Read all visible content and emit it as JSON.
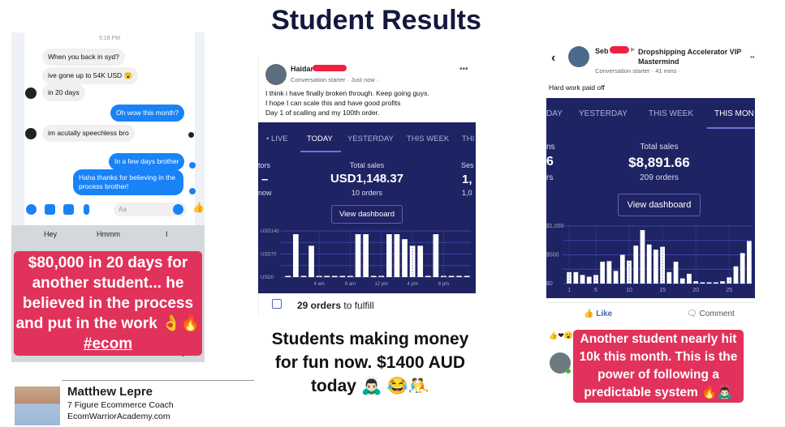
{
  "title": "Student Results",
  "chat": {
    "time": "5:18 PM",
    "messages": [
      {
        "dir": "in",
        "text": "When you back in syd?"
      },
      {
        "dir": "in",
        "text": "ive gone up to 54K USD 😮"
      },
      {
        "dir": "in",
        "text": "in 20 days"
      },
      {
        "dir": "out",
        "text": "Oh wow this month?"
      },
      {
        "dir": "in",
        "text": "im acutally speechless bro"
      },
      {
        "dir": "out",
        "text": "In a few days brother"
      },
      {
        "dir": "out",
        "text": "Haha thanks for believing in the process brother!"
      }
    ],
    "input_placeholder": "Aa",
    "suggestions": [
      "Hey",
      "Hmmm",
      "I"
    ],
    "caption": "$80,000 in 20 days for another student... he believed in the process and put in the work 👌🔥",
    "hashtag": "#ecom"
  },
  "coach": {
    "name": "Matthew Lepre",
    "role": "7 Figure Ecommerce Coach",
    "site": "EcomWarriorAcademy.com"
  },
  "post1": {
    "author": "Haidar",
    "meta": "Conversation starter · Just now ·",
    "text": [
      "I think i have finally broken through. Keep going guys.",
      "I hope I can scale this and have good profits",
      "Day 1 of scalling and my 100th order."
    ],
    "tabs": [
      "• LIVE",
      "TODAY",
      "YESTERDAY",
      "THIS WEEK",
      "THI"
    ],
    "active_tab": "TODAY",
    "left_stat": {
      "label": "tors",
      "value": "–",
      "sub": "now"
    },
    "right_stat": {
      "label": "Ses",
      "value": "1,",
      "sub": "1,0"
    },
    "total_label": "Total sales",
    "total": "USD1,148.37",
    "orders": "10 orders",
    "button": "View dashboard",
    "fulfill_bold": "29 orders",
    "fulfill_rest": " to fulfill"
  },
  "middle_caption": "Students making money for fun now. $1400 AUD today 🙇🏻‍♂️ 😂🤼",
  "post2": {
    "author": "Seb",
    "group": "Dropshipping Accelerator VIP Mastermind",
    "meta": "Conversation starter · 41 mins ·",
    "text": "Hard work paid off",
    "tabs": [
      "DAY",
      "YESTERDAY",
      "THIS WEEK",
      "THIS MON"
    ],
    "active_tab": "THIS MON",
    "left_stat": {
      "label": "ns",
      "value": "6",
      "sub": "rs"
    },
    "total_label": "Total sales",
    "total": "$8,891.66",
    "orders": "209 orders",
    "button": "View dashboard",
    "like": "Like",
    "comment": "Comment",
    "caption": "Another student nearly hit 10k this month. This is the power of following a predictable system 🔥🙇🏻‍♂️"
  },
  "chart_data": [
    {
      "type": "bar",
      "ylabel": "",
      "xlabel": "",
      "y_ticks": [
        "USD140",
        "USD70",
        "USD0"
      ],
      "ylim": [
        0,
        140
      ],
      "x_ticks": [
        "4 am",
        "8 am",
        "12 pm",
        "4 pm",
        "8 pm"
      ],
      "categories": [
        0,
        1,
        2,
        3,
        4,
        5,
        6,
        7,
        8,
        9,
        10,
        11,
        12,
        13,
        14,
        15,
        16,
        17,
        18,
        19,
        20,
        21,
        22,
        23
      ],
      "values": [
        0,
        130,
        0,
        95,
        0,
        0,
        0,
        0,
        0,
        130,
        130,
        0,
        0,
        130,
        130,
        115,
        95,
        95,
        0,
        130,
        0,
        0,
        0,
        0
      ]
    },
    {
      "type": "bar",
      "ylabel": "",
      "xlabel": "",
      "y_ticks": [
        "$1,000",
        "$500",
        "$0"
      ],
      "ylim": [
        0,
        1000
      ],
      "x_ticks": [
        "1",
        "5",
        "10",
        "15",
        "20",
        "25"
      ],
      "categories": [
        1,
        2,
        3,
        4,
        5,
        6,
        7,
        8,
        9,
        10,
        11,
        12,
        13,
        14,
        15,
        16,
        17,
        18,
        19,
        20,
        21,
        22,
        23,
        24,
        25,
        26,
        27,
        28
      ],
      "values": [
        200,
        200,
        150,
        120,
        150,
        380,
        390,
        220,
        500,
        400,
        660,
        930,
        680,
        590,
        640,
        200,
        380,
        90,
        170,
        40,
        20,
        20,
        20,
        40,
        110,
        300,
        530,
        740
      ]
    }
  ],
  "colors": {
    "dashboard": "#1e2364",
    "caption": "#e0325a",
    "messenger": "#1a82f7",
    "title": "#14183f"
  }
}
